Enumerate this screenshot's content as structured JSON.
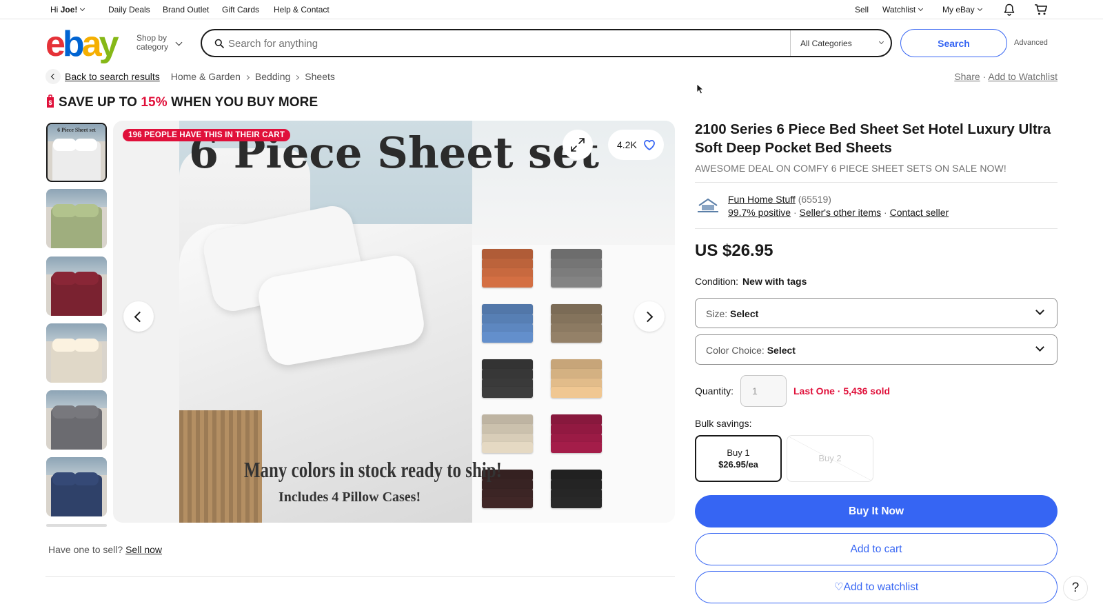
{
  "topbar": {
    "greeting": "Hi",
    "user": "Joe!",
    "links": [
      "Daily Deals",
      "Brand Outlet",
      "Gift Cards",
      "Help & Contact"
    ],
    "sell": "Sell",
    "watchlist": "Watchlist",
    "my_ebay": "My eBay"
  },
  "header": {
    "logo": {
      "e": "e",
      "b": "b",
      "a": "a",
      "y": "y"
    },
    "shop_by_line1": "Shop by",
    "shop_by_line2": "category",
    "search_placeholder": "Search for anything",
    "category": "All Categories",
    "search_button": "Search",
    "advanced": "Advanced"
  },
  "breadcrumb": {
    "back": "Back to search results",
    "items": [
      "Home & Garden",
      "Bedding",
      "Sheets"
    ],
    "share": "Share",
    "dot": "·",
    "add_watchlist": "Add to Watchlist"
  },
  "promo": {
    "prefix": "SAVE UP TO",
    "percent": "15%",
    "suffix": "WHEN YOU BUY MORE"
  },
  "gallery": {
    "cart_badge": "196 PEOPLE HAVE THIS IN THEIR CART",
    "watch_count": "4.2K",
    "image_title": "6 Piece Sheet set",
    "image_caption1": "Many colors in stock ready to ship!",
    "image_caption2": "Includes 4 Pillow Cases!",
    "thumb_label": "6 Piece Sheet set",
    "swatch_colors": [
      "#c8693f",
      "#7c7c7c",
      "#5d87c0",
      "#8c7a62",
      "#3a3a3a",
      "#e2bc8a",
      "#d8cdb8",
      "#9b1b45",
      "#3c2525",
      "#262626"
    ],
    "thumb_colors": [
      "#ececec",
      "#9fae7e",
      "#7a2230",
      "#e0d8c8",
      "#6b6b70",
      "#2f4169"
    ]
  },
  "sell_prompt": {
    "text": "Have one to sell?",
    "link": "Sell now"
  },
  "item": {
    "title": "2100 Series 6 Piece Bed Sheet Set Hotel Luxury Ultra Soft Deep Pocket Bed Sheets",
    "subtitle": "AWESOME DEAL ON COMFY 6 PIECE SHEET SETS ON SALE NOW!",
    "seller": {
      "name": "Fun Home Stuff",
      "feedback": "(65519)",
      "positive": "99.7% positive",
      "other_items": "Seller's other items",
      "contact": "Contact seller",
      "dot": "·"
    },
    "price": "US $26.95",
    "condition_label": "Condition:",
    "condition_value": "New with tags",
    "size_label": "Size:",
    "size_value": "Select",
    "color_label": "Color Choice:",
    "color_value": "Select",
    "quantity_label": "Quantity:",
    "quantity_value": "1",
    "last_one": "Last One",
    "sold": "5,436 sold",
    "bulk_label": "Bulk savings:",
    "bulk_options": [
      {
        "qty": "Buy 1",
        "price": "$26.95/ea"
      },
      {
        "qty": "Buy 2"
      }
    ],
    "buy_now": "Buy It Now",
    "add_to_cart": "Add to cart",
    "add_to_watchlist": "Add to watchlist"
  },
  "help": "?",
  "colors": {
    "brand_blue": "#3665f3",
    "alert_red": "#e0103a"
  }
}
